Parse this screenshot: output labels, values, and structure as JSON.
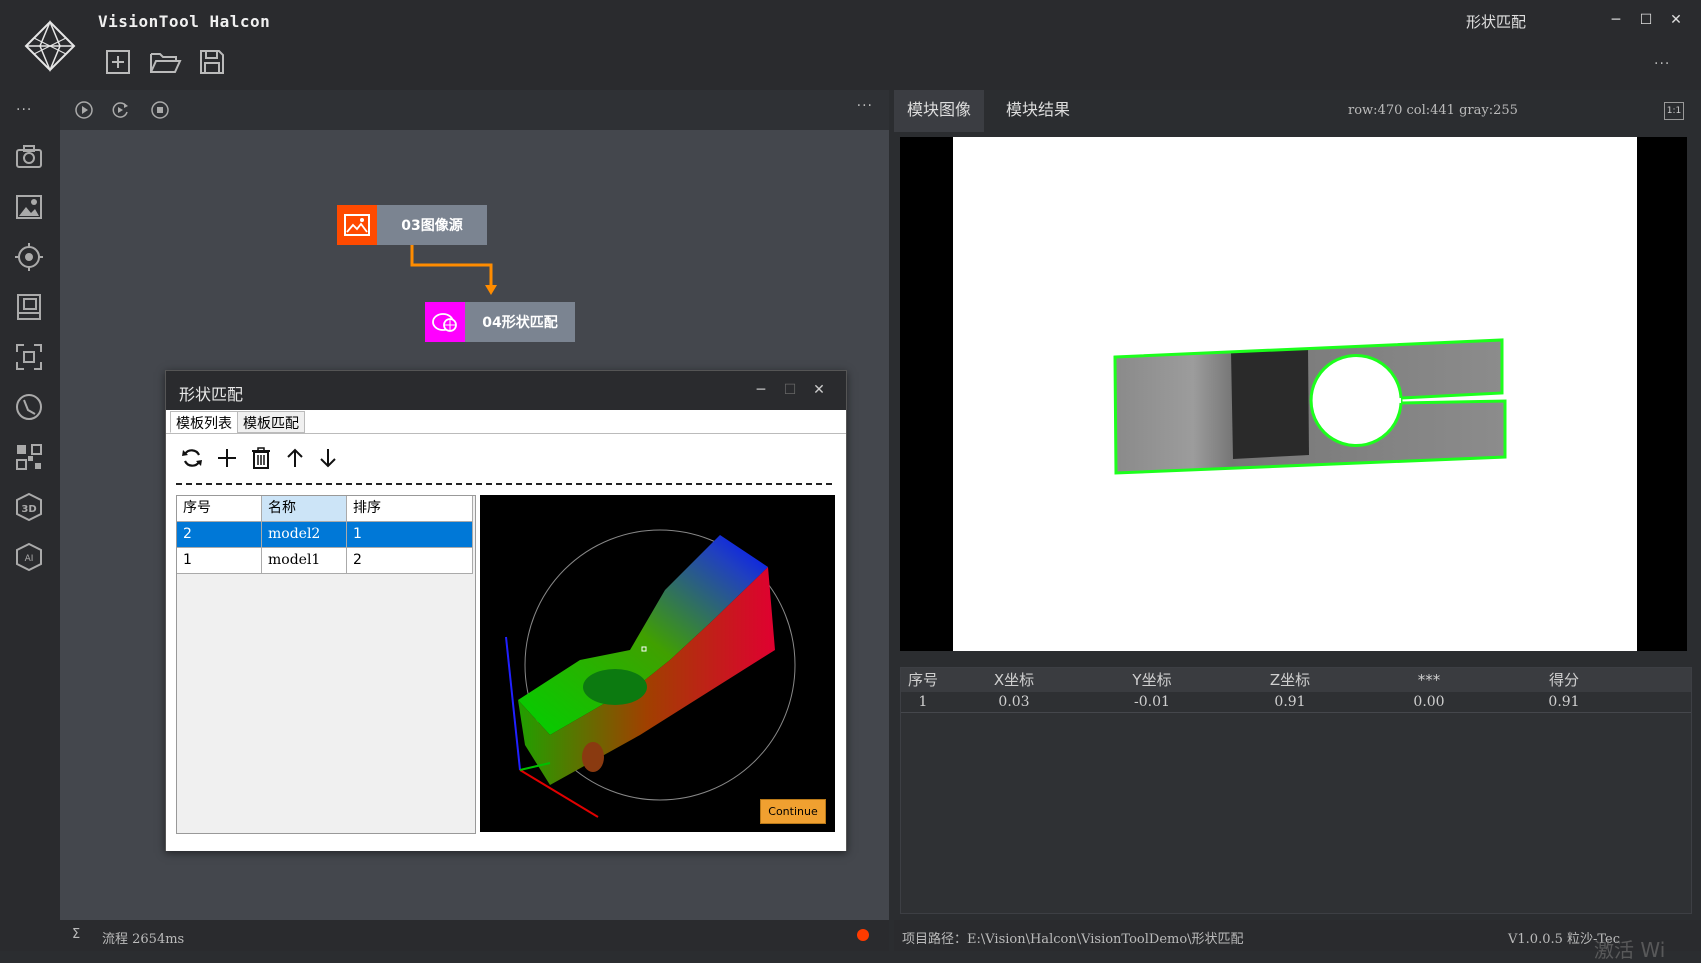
{
  "app": {
    "title": "VisionTool Halcon",
    "window_title": "形状匹配",
    "more": "···"
  },
  "toolbar": {
    "icons": [
      "new-file-icon",
      "open-folder-icon",
      "save-icon"
    ]
  },
  "sidebar": {
    "more": "···",
    "icons": [
      "camera-icon",
      "image-settings-icon",
      "target-icon",
      "film-icon",
      "focus-frame-icon",
      "measure-icon",
      "qr-code-icon",
      "3d-icon",
      "ai-icon"
    ]
  },
  "flow": {
    "more": "···",
    "nodes": [
      {
        "label": "03图像源",
        "color": "#ff4a00"
      },
      {
        "label": "04形状匹配",
        "color": "#ff00ff"
      }
    ],
    "connector_color": "#ff8c00"
  },
  "dialog": {
    "title": "形状匹配",
    "tabs": [
      "模板列表",
      "模板匹配"
    ],
    "table": {
      "headers": [
        "序号",
        "名称",
        "排序"
      ],
      "rows": [
        {
          "id": "2",
          "name": "model2",
          "order": "1"
        },
        {
          "id": "1",
          "name": "model1",
          "order": "2"
        }
      ]
    },
    "continue_label": "Continue"
  },
  "right": {
    "tabs": [
      "模块图像",
      "模块结果"
    ],
    "pixel_info": "row:470 col:441 gray:255",
    "ratio": "1:1",
    "results": {
      "headers": [
        "序号",
        "X坐标",
        "Y坐标",
        "Z坐标",
        "***",
        "得分"
      ],
      "rows": [
        [
          "1",
          "0.03",
          "-0.01",
          "0.91",
          "0.00",
          "0.91"
        ]
      ]
    }
  },
  "status": {
    "left": "流程 2654ms",
    "sigma": "Σ",
    "project_path": "项目路径：E:\\Vision\\Halcon\\VisionToolDemo\\形状匹配",
    "version": "V1.0.0.5 粒沙-Tec",
    "watermark": "激活 Wi"
  }
}
